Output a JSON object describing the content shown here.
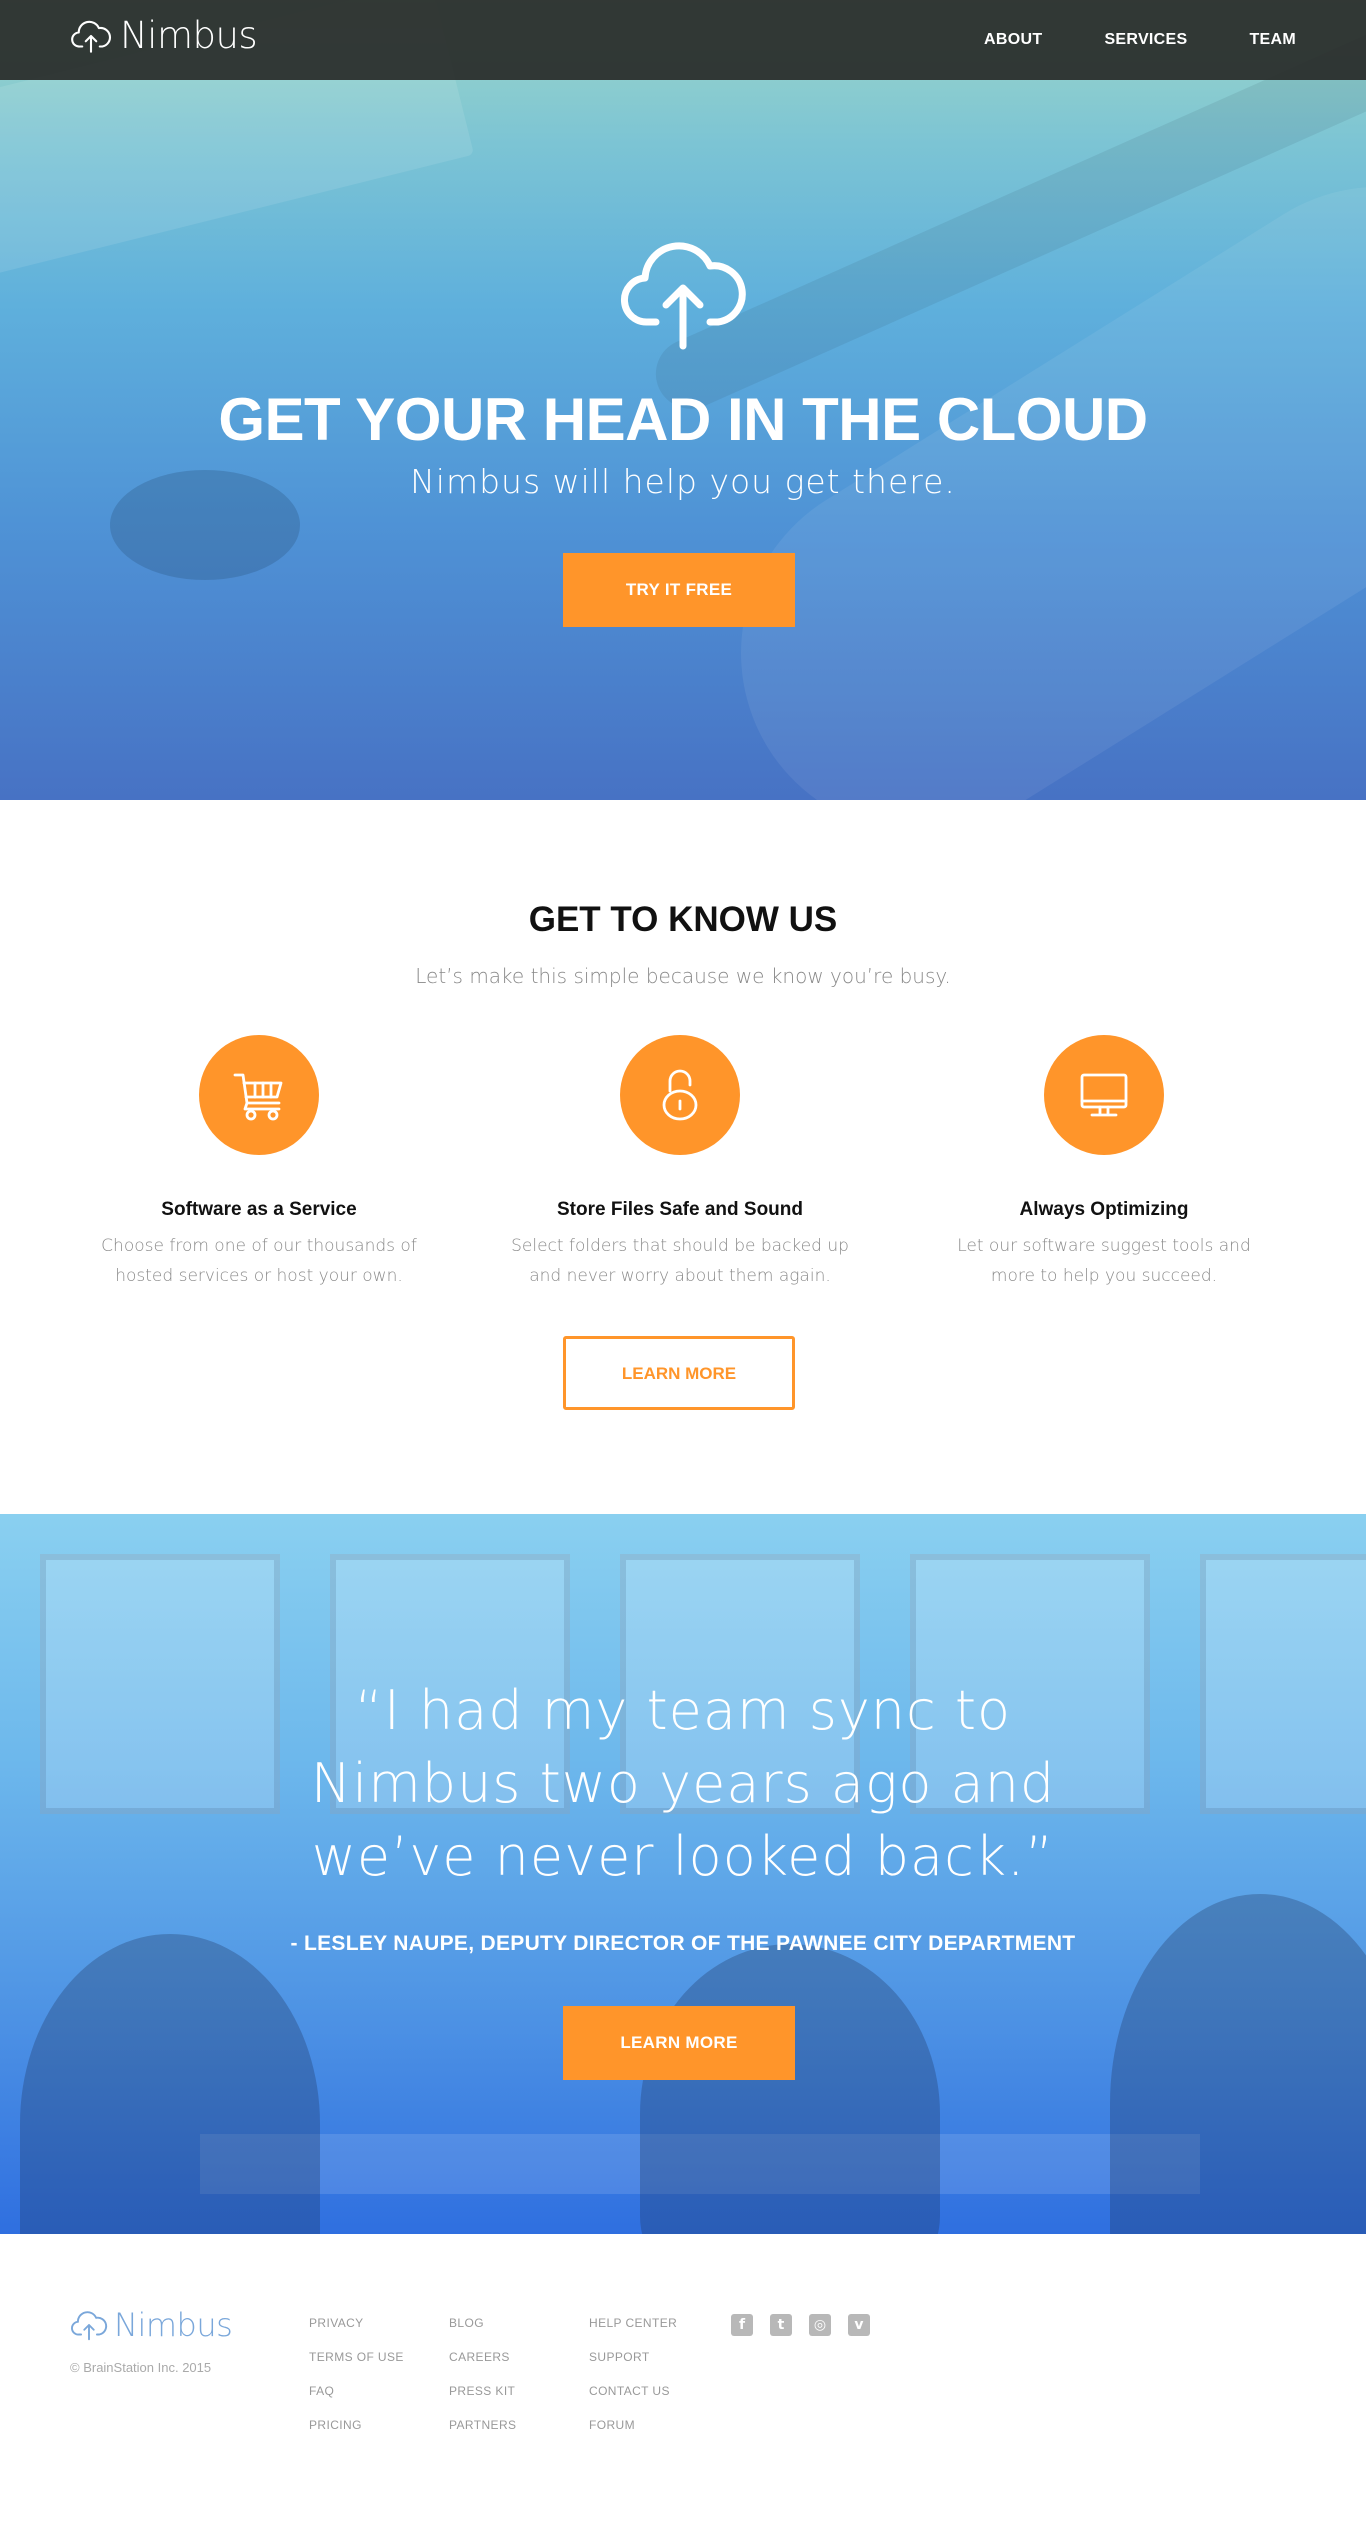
{
  "header": {
    "logo_text": "Nimbus",
    "nav": [
      "ABOUT",
      "SERVICES",
      "TEAM"
    ]
  },
  "hero": {
    "icon": "cloud-upload-icon",
    "title": "GET YOUR HEAD IN THE CLOUD",
    "subtitle": "Nimbus will help you get there.",
    "cta_label": "TRY IT FREE"
  },
  "about": {
    "title": "GET TO KNOW US",
    "subtitle": "Let’s make this simple because we know you’re busy.",
    "features": [
      {
        "icon": "shopping-cart-icon",
        "title": "Software as a Service",
        "description": "Choose from one of our thousands of hosted services or host your own."
      },
      {
        "icon": "padlock-icon",
        "title": "Store Files Safe and Sound",
        "description": "Select folders that should be backed up and never worry about them again."
      },
      {
        "icon": "monitor-icon",
        "title": "Always Optimizing",
        "description": "Let our software suggest tools and more to help you succeed."
      }
    ],
    "cta_label": "LEARN MORE"
  },
  "testimonial": {
    "quote": "“I had my team sync to Nimbus two years ago and we’ve never looked back.”",
    "author": "- LESLEY NAUPE, DEPUTY DIRECTOR OF THE PAWNEE CITY DEPARTMENT",
    "cta_label": "LEARN MORE"
  },
  "footer": {
    "logo_text": "Nimbus",
    "copyright": "© BrainStation Inc. 2015",
    "columns": [
      [
        "PRIVACY",
        "TERMS OF USE",
        "FAQ",
        "PRICING"
      ],
      [
        "BLOG",
        "CAREERS",
        "PRESS KIT",
        "PARTNERS"
      ],
      [
        "HELP CENTER",
        "SUPPORT",
        "CONTACT US",
        "FORUM"
      ]
    ],
    "social": [
      "facebook-icon",
      "twitter-icon",
      "instagram-icon",
      "vimeo-icon"
    ]
  },
  "colors": {
    "accent": "#ff952a",
    "header_bg": "#2a2c2a",
    "footer_logo": "#7aa7da"
  }
}
